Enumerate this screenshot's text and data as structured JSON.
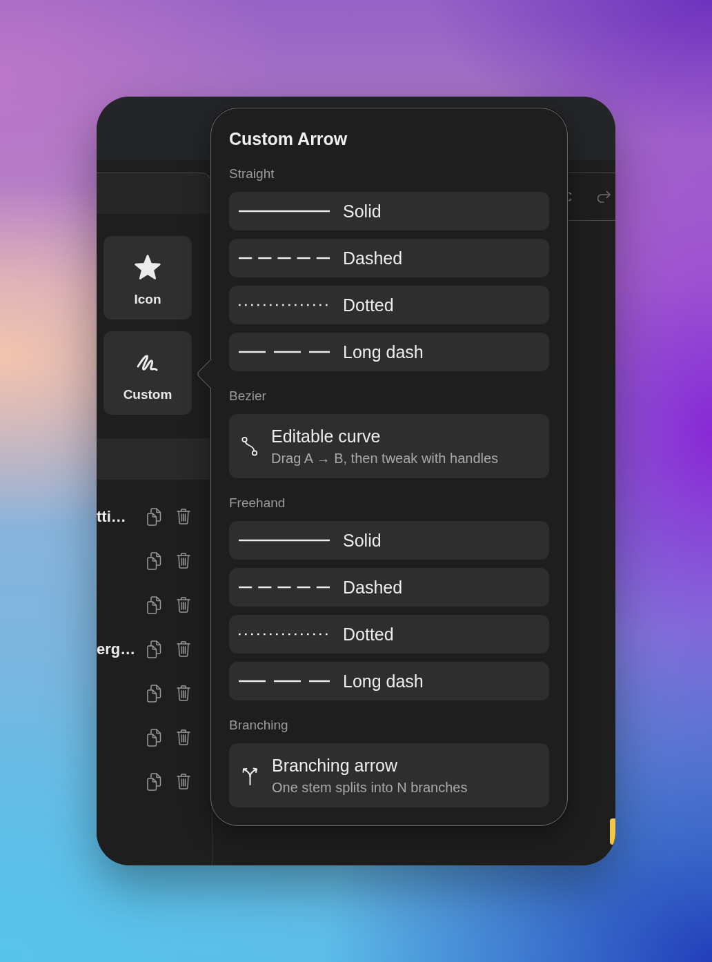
{
  "sidebar": {
    "tiles": [
      {
        "kind": "star",
        "label": "Icon"
      },
      {
        "kind": "scribble",
        "label": "Custom"
      }
    ],
    "rows": [
      {
        "label": "tti…"
      },
      {},
      {},
      {
        "label": "erg…"
      },
      {},
      {},
      {}
    ]
  },
  "popover": {
    "title": "Custom Arrow",
    "sections": [
      {
        "label": "Straight",
        "options": [
          {
            "kind": "solid",
            "label": "Solid"
          },
          {
            "kind": "dashed",
            "label": "Dashed"
          },
          {
            "kind": "dotted",
            "label": "Dotted"
          },
          {
            "kind": "long_dash",
            "label": "Long dash"
          }
        ]
      },
      {
        "label": "Bezier",
        "options": [
          {
            "kind": "curve",
            "label": "Editable curve",
            "description": "Drag A → B, then tweak with handles"
          }
        ]
      },
      {
        "label": "Freehand",
        "options": [
          {
            "kind": "solid",
            "label": "Solid"
          },
          {
            "kind": "dashed",
            "label": "Dashed"
          },
          {
            "kind": "dotted",
            "label": "Dotted"
          },
          {
            "kind": "long_dash",
            "label": "Long dash"
          }
        ]
      },
      {
        "label": "Branching",
        "options": [
          {
            "kind": "branch",
            "label": "Branching arrow",
            "description": "One stem splits into N branches"
          }
        ]
      }
    ]
  }
}
